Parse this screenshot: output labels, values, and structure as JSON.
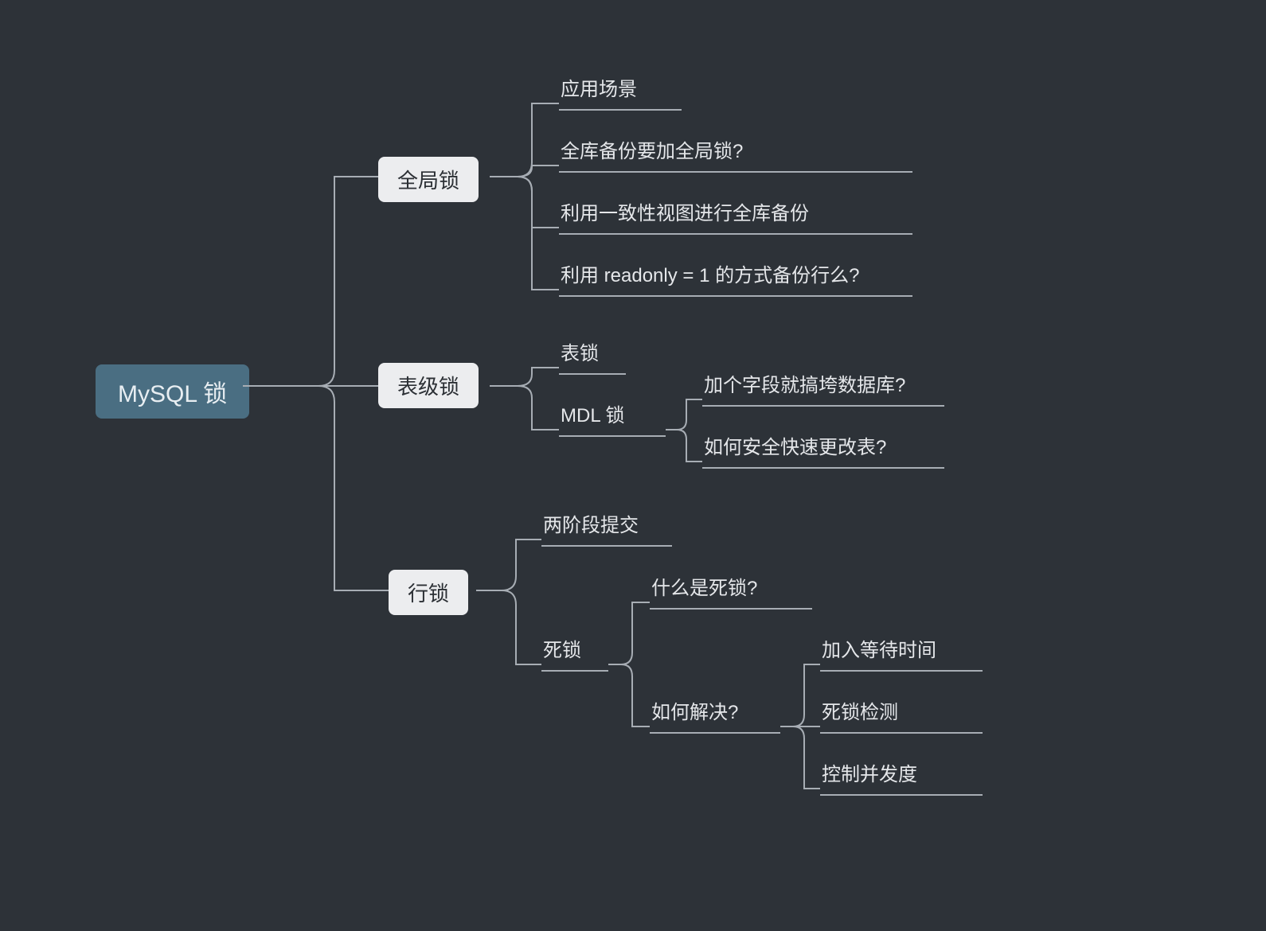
{
  "root": {
    "title": "MySQL 锁"
  },
  "level1": {
    "global": {
      "label": "全局锁",
      "leaves": [
        "应用场景",
        "全库备份要加全局锁?",
        "利用一致性视图进行全库备份",
        "利用 readonly = 1 的方式备份行么?"
      ]
    },
    "table": {
      "label": "表级锁",
      "tablelock": "表锁",
      "mdl": {
        "label": "MDL 锁",
        "leaves": [
          "加个字段就搞垮数据库?",
          "如何安全快速更改表?"
        ]
      }
    },
    "row": {
      "label": "行锁",
      "twophase": "两阶段提交",
      "deadlock": {
        "label": "死锁",
        "whatis": "什么是死锁?",
        "howsolve": {
          "label": "如何解决?",
          "leaves": [
            "加入等待时间",
            "死锁检测",
            "控制并发度"
          ]
        }
      }
    }
  }
}
